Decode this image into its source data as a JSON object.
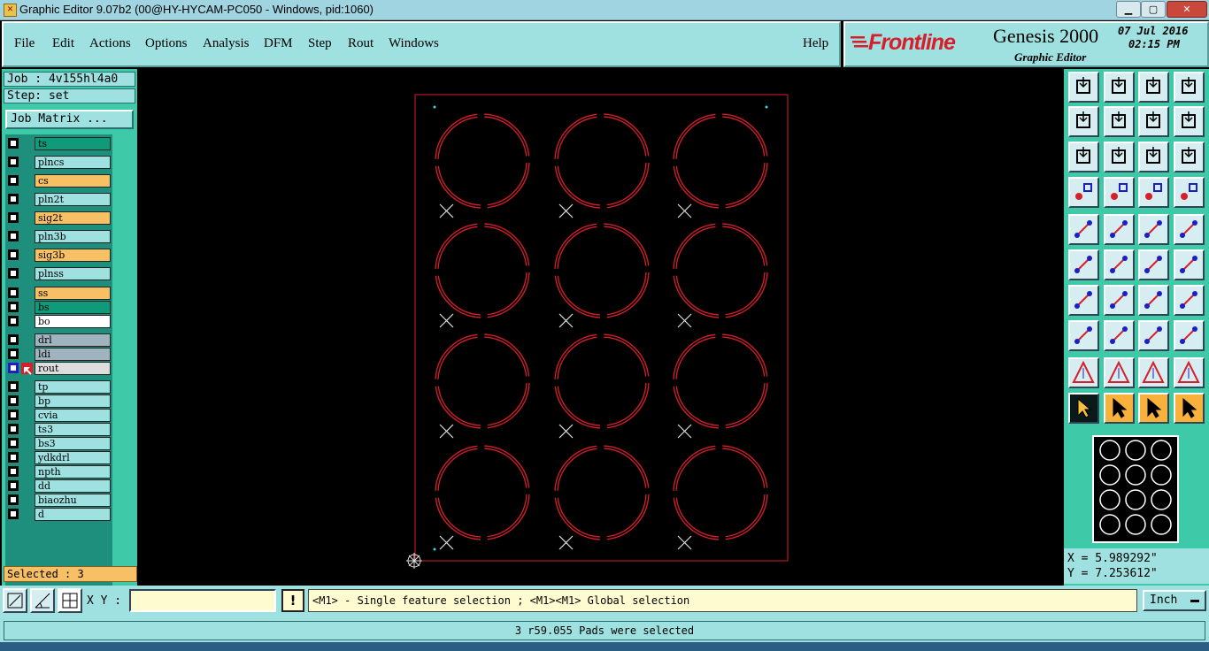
{
  "window": {
    "title": "Graphic Editor 9.07b2 (00@HY-HYCAM-PC050 - Windows, pid:1060)",
    "min_glyph": "▁",
    "max_glyph": "▢",
    "close_glyph": "✕"
  },
  "menu": [
    "File",
    "Edit",
    "Actions",
    "Options",
    "Analysis",
    "DFM",
    "Step",
    "Rout",
    "Windows"
  ],
  "help": "Help",
  "brand": {
    "logo": "Frontline",
    "product": "Genesis 2000",
    "subtitle": "Graphic Editor",
    "date": "07 Jul 2016",
    "time": "02:15 PM"
  },
  "job": {
    "job_label": "Job : 4v155hl4a0",
    "step_label": "Step: set",
    "matrix_button": "Job Matrix ..."
  },
  "layers": [
    {
      "name": "ts",
      "color": "#0f9a7a"
    },
    {
      "name": "plncs",
      "color": "#9fe0e0"
    },
    {
      "name": "cs",
      "color": "#f8c064"
    },
    {
      "name": "pln2t",
      "color": "#9fe0e0"
    },
    {
      "name": "sig2t",
      "color": "#f8c064"
    },
    {
      "name": "pln3b",
      "color": "#9fe0e0"
    },
    {
      "name": "sig3b",
      "color": "#f8c064"
    },
    {
      "name": "plnss",
      "color": "#9fe0e0"
    },
    {
      "name": "ss",
      "color": "#f8c064"
    },
    {
      "name": "bs",
      "color": "#0f9a7a"
    },
    {
      "name": "bo",
      "color": "#ffffff"
    },
    {
      "name": "drl",
      "color": "#a0b4c0"
    },
    {
      "name": "ldi",
      "color": "#a0b4c0"
    },
    {
      "name": "rout",
      "color": "#dddddd",
      "active": true
    },
    {
      "name": "tp",
      "color": "#9fe0e0"
    },
    {
      "name": "bp",
      "color": "#9fe0e0"
    },
    {
      "name": "cvia",
      "color": "#9fe0e0"
    },
    {
      "name": "ts3",
      "color": "#9fe0e0"
    },
    {
      "name": "bs3",
      "color": "#9fe0e0"
    },
    {
      "name": "ydkdrl",
      "color": "#9fe0e0"
    },
    {
      "name": "npth",
      "color": "#9fe0e0"
    },
    {
      "name": "dd",
      "color": "#9fe0e0"
    },
    {
      "name": "biaozhu",
      "color": "#9fe0e0"
    },
    {
      "name": "d",
      "color": "#9fe0e0"
    }
  ],
  "selected_label": "Selected : 3",
  "coords": {
    "x": "X =  5.989292\"",
    "y": "Y =  7.253612\""
  },
  "xy_label": "X Y :",
  "xy_value": "",
  "warn_glyph": "!",
  "hint": "<M1> - Single feature selection ; <M1><M1> Global selection",
  "units": "Inch",
  "status": "3 r59.055 Pads were selected",
  "colors": {
    "rout": "#d81e2a",
    "panel": "#3ec9a9",
    "menu": "#9fe0e0"
  }
}
